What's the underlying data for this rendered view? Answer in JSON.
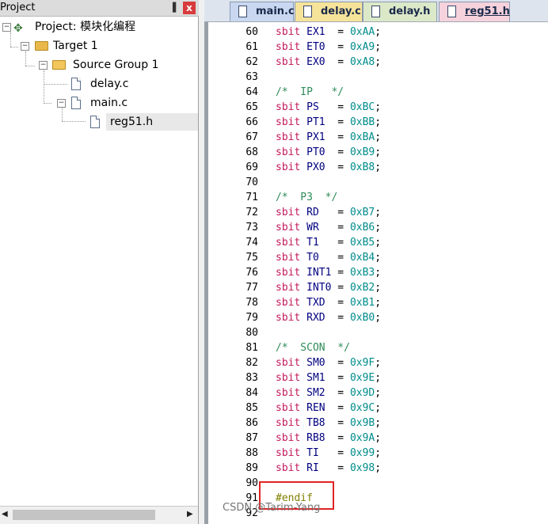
{
  "project_panel": {
    "title": "Project",
    "pin_glyph": "▐",
    "close_glyph": "x",
    "tree": {
      "root": "Project: 模块化编程",
      "target": "Target 1",
      "group": "Source Group 1",
      "files": [
        "delay.c",
        "main.c",
        "reg51.h"
      ]
    },
    "scrollbar": {
      "left_arrow": "◀",
      "right_arrow": "▶"
    }
  },
  "editor": {
    "tabs": [
      {
        "label": "main.c",
        "color": "#c9d8f0"
      },
      {
        "label": "delay.c",
        "color": "#f6e39a"
      },
      {
        "label": "delay.h",
        "color": "#dce9c8"
      },
      {
        "label": "reg51.h",
        "color": "#f5d2dc",
        "active": true
      }
    ],
    "lines": [
      {
        "n": "60",
        "t": "sbit EX1  = 0xAA;"
      },
      {
        "n": "61",
        "t": "sbit ET0  = 0xA9;"
      },
      {
        "n": "62",
        "t": "sbit EX0  = 0xA8;"
      },
      {
        "n": "63",
        "t": ""
      },
      {
        "n": "64",
        "t": "/*  IP   */"
      },
      {
        "n": "65",
        "t": "sbit PS   = 0xBC;"
      },
      {
        "n": "66",
        "t": "sbit PT1  = 0xBB;"
      },
      {
        "n": "67",
        "t": "sbit PX1  = 0xBA;"
      },
      {
        "n": "68",
        "t": "sbit PT0  = 0xB9;"
      },
      {
        "n": "69",
        "t": "sbit PX0  = 0xB8;"
      },
      {
        "n": "70",
        "t": ""
      },
      {
        "n": "71",
        "t": "/*  P3  */"
      },
      {
        "n": "72",
        "t": "sbit RD   = 0xB7;"
      },
      {
        "n": "73",
        "t": "sbit WR   = 0xB6;"
      },
      {
        "n": "74",
        "t": "sbit T1   = 0xB5;"
      },
      {
        "n": "75",
        "t": "sbit T0   = 0xB4;"
      },
      {
        "n": "76",
        "t": "sbit INT1 = 0xB3;"
      },
      {
        "n": "77",
        "t": "sbit INT0 = 0xB2;"
      },
      {
        "n": "78",
        "t": "sbit TXD  = 0xB1;"
      },
      {
        "n": "79",
        "t": "sbit RXD  = 0xB0;"
      },
      {
        "n": "80",
        "t": ""
      },
      {
        "n": "81",
        "t": "/*  SCON  */"
      },
      {
        "n": "82",
        "t": "sbit SM0  = 0x9F;"
      },
      {
        "n": "83",
        "t": "sbit SM1  = 0x9E;"
      },
      {
        "n": "84",
        "t": "sbit SM2  = 0x9D;"
      },
      {
        "n": "85",
        "t": "sbit REN  = 0x9C;"
      },
      {
        "n": "86",
        "t": "sbit TB8  = 0x9B;"
      },
      {
        "n": "87",
        "t": "sbit RB8  = 0x9A;"
      },
      {
        "n": "88",
        "t": "sbit TI   = 0x99;"
      },
      {
        "n": "89",
        "t": "sbit RI   = 0x98;"
      },
      {
        "n": "90",
        "t": ""
      },
      {
        "n": "91",
        "t": "#endif"
      },
      {
        "n": "92",
        "t": ""
      }
    ]
  },
  "watermark": "CSDN @Tarim-Yang",
  "colors": {
    "keyword": "#c2185b",
    "hex": "#008b8b",
    "comment": "#2e8b57",
    "preprocessor": "#808000",
    "highlight": "#e02424"
  }
}
